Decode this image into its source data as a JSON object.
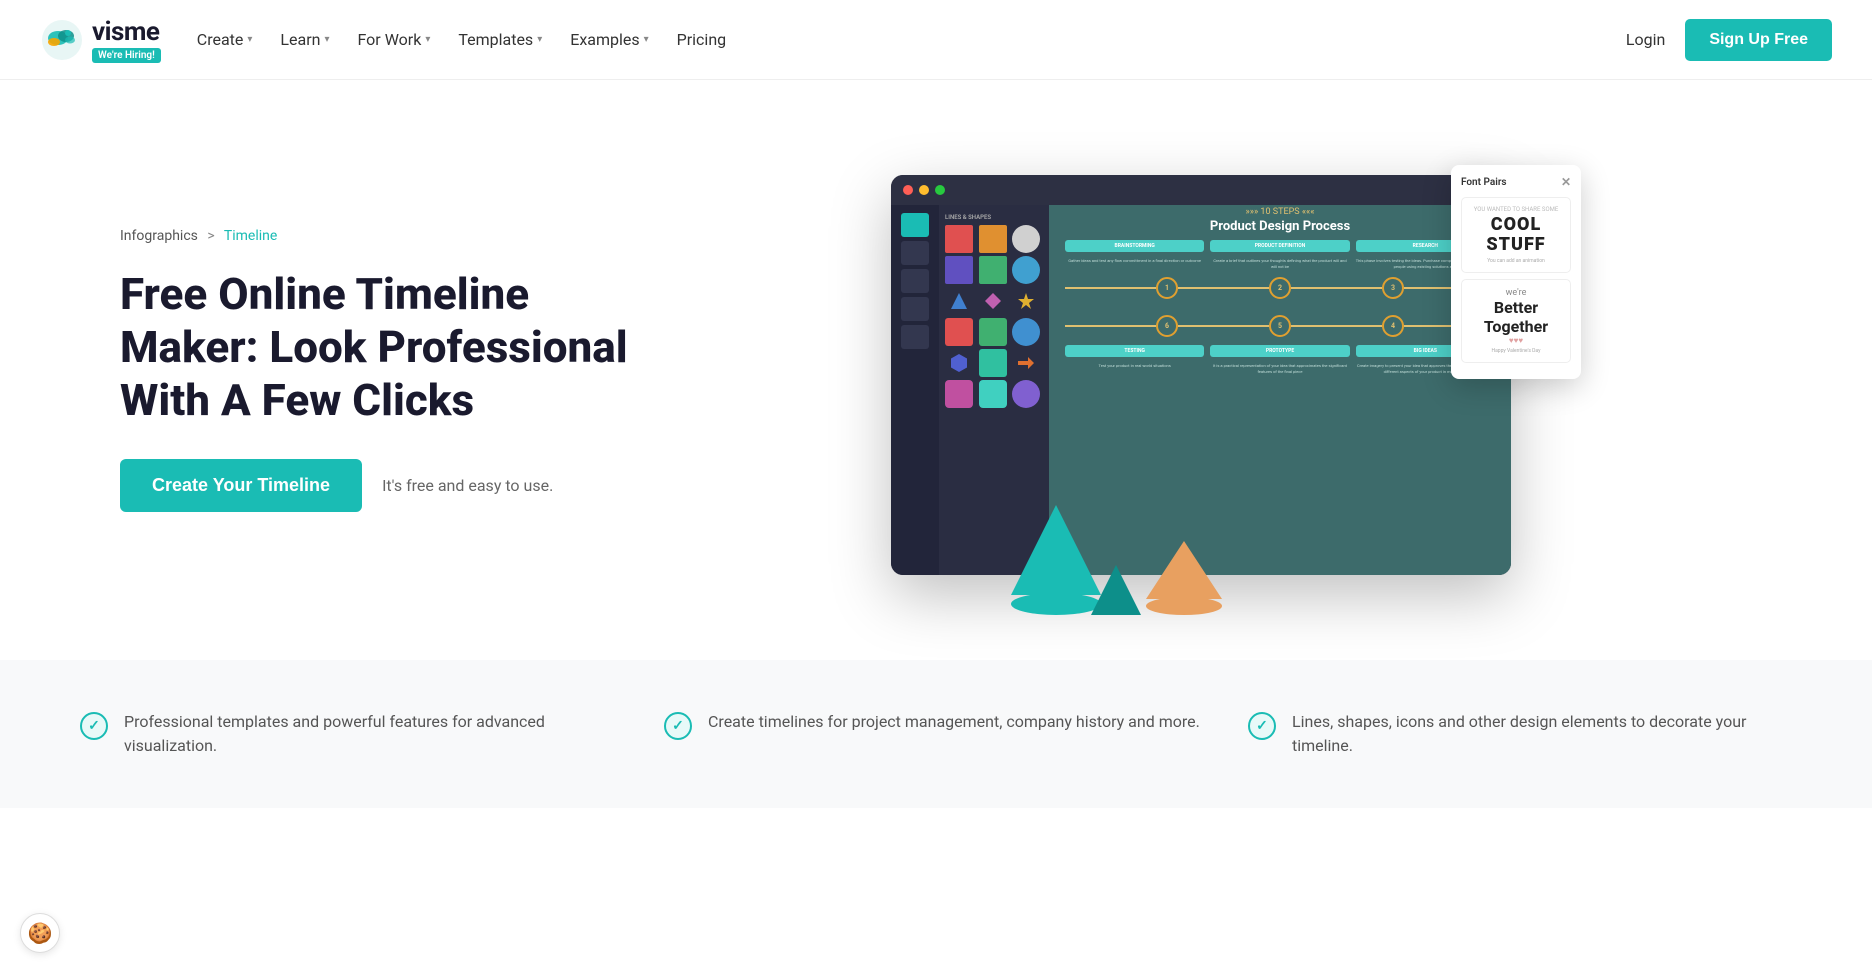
{
  "nav": {
    "logo_text": "visme",
    "hiring_label": "We're Hiring!",
    "links": [
      {
        "label": "Create",
        "has_dropdown": true
      },
      {
        "label": "Learn",
        "has_dropdown": true
      },
      {
        "label": "For Work",
        "has_dropdown": true
      },
      {
        "label": "Templates",
        "has_dropdown": true
      },
      {
        "label": "Examples",
        "has_dropdown": true
      },
      {
        "label": "Pricing",
        "has_dropdown": false
      }
    ],
    "login_label": "Login",
    "signup_label": "Sign Up Free"
  },
  "hero": {
    "breadcrumb_parent": "Infographics",
    "breadcrumb_sep": ">",
    "breadcrumb_current": "Timeline",
    "title": "Free Online Timeline Maker: Look Professional With A Few Clicks",
    "cta_label": "Create Your Timeline",
    "cta_subtitle": "It's free and easy to use."
  },
  "mockup": {
    "canvas_label": "10 STEPS",
    "canvas_title": "Product Design Process",
    "font_panel_title": "Font Pairs",
    "font_cool": "COOL",
    "font_stuff": "STUFF",
    "font_tagline1": "You can add an animation",
    "font_better": "we're",
    "font_together": "Better Together",
    "font_hearts": "♥♥♥",
    "font_tagline2": "Happy Valentine's Day",
    "tl_boxes": [
      "BRAINSTORMING",
      "PRODUCT DEFINITION",
      "RESEARCH"
    ],
    "tl_boxes2": [
      "TESTING",
      "PROTOTYPE",
      "BIG IDEAS"
    ],
    "tl_circles": [
      "1",
      "2",
      "3",
      "6",
      "5",
      "4"
    ]
  },
  "features": [
    {
      "text": "Professional templates and powerful features for advanced visualization."
    },
    {
      "text": "Create timelines for project management, company history and more."
    },
    {
      "text": "Lines, shapes, icons and other design elements to decorate your timeline."
    }
  ],
  "colors": {
    "brand_teal": "#1abcb4",
    "dark_navy": "#1a1d2e",
    "gold": "#e0c070"
  }
}
